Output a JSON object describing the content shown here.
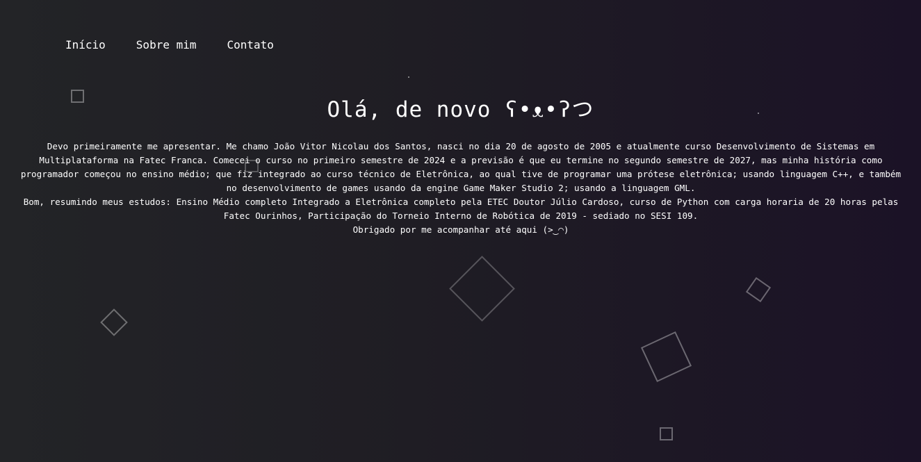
{
  "nav": {
    "items": [
      {
        "label": "Início"
      },
      {
        "label": "Sobre mim"
      },
      {
        "label": "Contato"
      }
    ]
  },
  "hero": {
    "title": "Olá, de novo ʕ•ᴥ•ʔつ"
  },
  "about": {
    "paragraph1": "Devo primeiramente me apresentar. Me chamo João Vitor Nicolau dos Santos, nasci no dia 20 de agosto de 2005 e atualmente curso Desenvolvimento de Sistemas em Multiplataforma na Fatec Franca. Comecei o curso no primeiro semestre de 2024 e a previsão é que eu termine no segundo semestre de 2027, mas minha história como programador começou no ensino médio; que fiz integrado ao curso técnico de Eletrônica, ao qual tive de programar uma prótese eletrônica; usando linguagem C++, e também no desenvolvimento de games usando da engine Game Maker Studio 2; usando a linguagem GML.",
    "paragraph2": "Bom, resumindo meus estudos: Ensino Médio completo Integrado a Eletrônica completo pela ETEC Doutor Júlio Cardoso, curso de Python com carga horaria de 20 horas pelas Fatec Ourinhos, Participação do Torneio Interno de Robótica de 2019 - sediado no SESI 109.",
    "paragraph3": "Obrigado por me acompanhar até aqui (>‿◠)"
  }
}
